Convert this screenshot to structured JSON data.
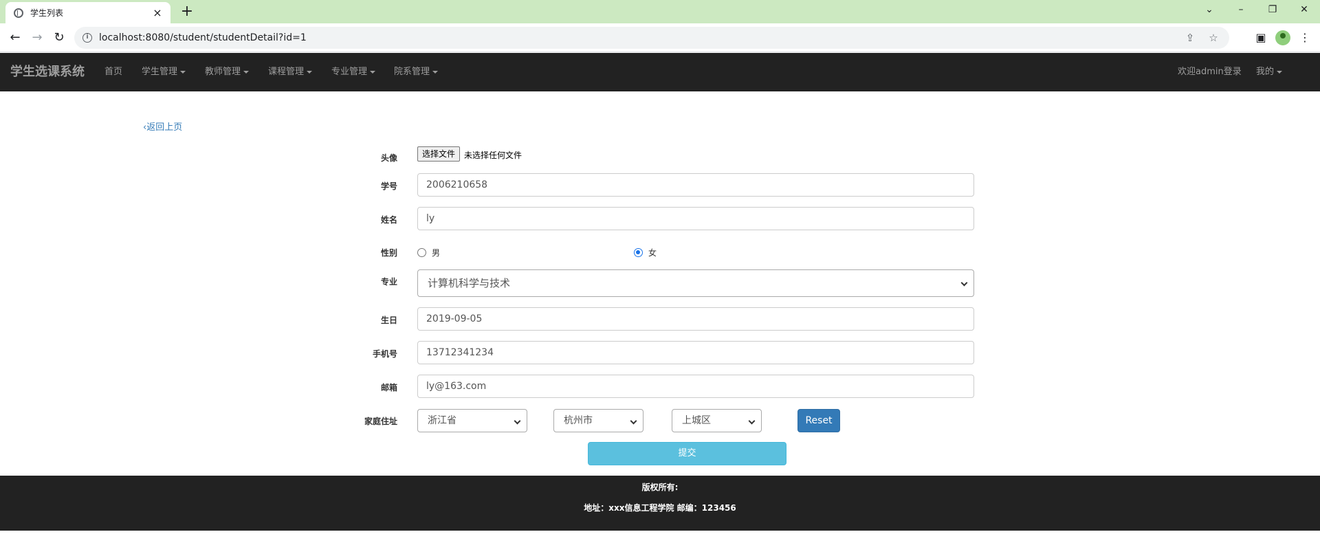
{
  "browser": {
    "tab_title": "学生列表",
    "tab_close": "×",
    "new_tab": "+",
    "url": "localhost:8080/student/studentDetail?id=1",
    "window_controls": [
      "⌄",
      "–",
      "❐",
      "✕"
    ]
  },
  "navbar": {
    "brand": "学生选课系统",
    "items": [
      {
        "label": "首页",
        "dropdown": false
      },
      {
        "label": "学生管理",
        "dropdown": true
      },
      {
        "label": "教师管理",
        "dropdown": true
      },
      {
        "label": "课程管理",
        "dropdown": true
      },
      {
        "label": "专业管理",
        "dropdown": true
      },
      {
        "label": "院系管理",
        "dropdown": true
      }
    ],
    "welcome": "欢迎admin登录",
    "mine": "我的"
  },
  "back_link": "返回上页",
  "form": {
    "avatar": {
      "label": "头像",
      "button": "选择文件",
      "status": "未选择任何文件"
    },
    "student_id": {
      "label": "学号",
      "value": "2006210658"
    },
    "name": {
      "label": "姓名",
      "value": "ly"
    },
    "gender": {
      "label": "性别",
      "options": [
        "男",
        "女"
      ],
      "selected": "女"
    },
    "major": {
      "label": "专业",
      "value": "计算机科学与技术"
    },
    "birthday": {
      "label": "生日",
      "value": "2019-09-05"
    },
    "phone": {
      "label": "手机号",
      "value": "13712341234"
    },
    "email": {
      "label": "邮箱",
      "value": "ly@163.com"
    },
    "address": {
      "label": "家庭住址",
      "province": "浙江省",
      "city": "杭州市",
      "district": "上城区",
      "reset": "Reset"
    },
    "submit": "提交"
  },
  "footer": {
    "copyright": "版权所有:",
    "address": "地址：xxx信息工程学院 邮编：123456"
  }
}
